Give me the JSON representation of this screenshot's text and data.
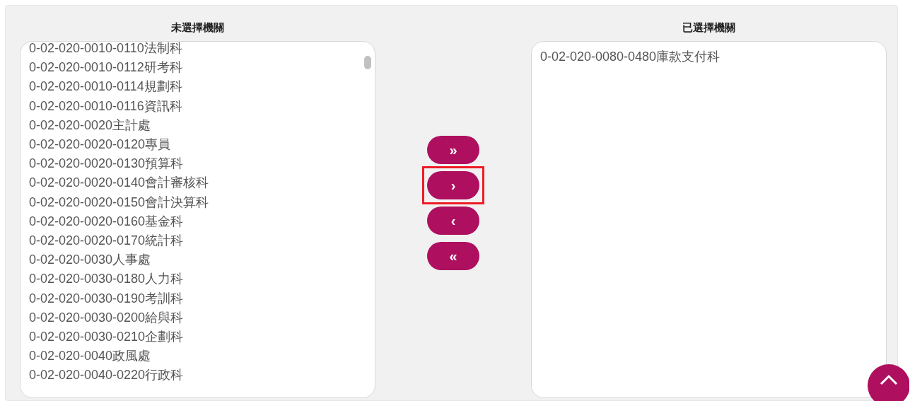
{
  "available": {
    "title": "未選擇機關",
    "items": [
      "0-02-020-0010-0110法制科",
      "0-02-020-0010-0112研考科",
      "0-02-020-0010-0114規劃科",
      "0-02-020-0010-0116資訊科",
      "0-02-020-0020主計處",
      "0-02-020-0020-0120專員",
      "0-02-020-0020-0130預算科",
      "0-02-020-0020-0140會計審核科",
      "0-02-020-0020-0150會計決算科",
      "0-02-020-0020-0160基金科",
      "0-02-020-0020-0170統計科",
      "0-02-020-0030人事處",
      "0-02-020-0030-0180人力科",
      "0-02-020-0030-0190考訓科",
      "0-02-020-0030-0200給與科",
      "0-02-020-0030-0210企劃科",
      "0-02-020-0040政風處",
      "0-02-020-0040-0220行政科"
    ]
  },
  "move_buttons": [
    {
      "label": "»",
      "highlighted": false
    },
    {
      "label": "›",
      "highlighted": true
    },
    {
      "label": "‹",
      "highlighted": false
    },
    {
      "label": "«",
      "highlighted": false
    }
  ],
  "selected": {
    "title": "已選擇機關",
    "items": [
      "0-02-020-0080-0480庫款支付科"
    ]
  }
}
